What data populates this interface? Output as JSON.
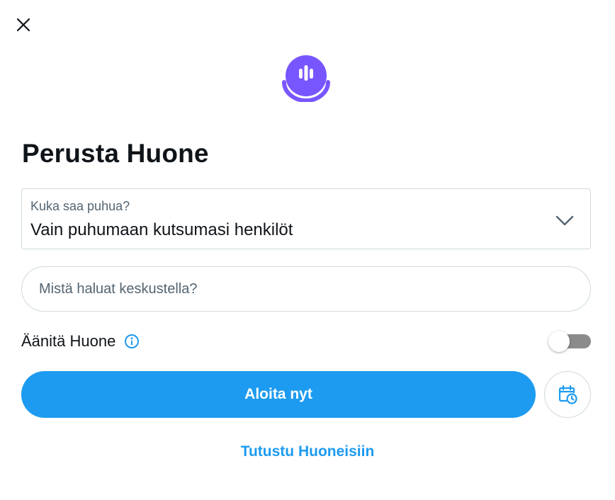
{
  "dialog": {
    "title": "Perusta Huone",
    "close_icon": "close-icon",
    "logo_icon": "spaces-logo-icon",
    "accent_color": "#1d9bf0",
    "logo_color": "#7856ff"
  },
  "speaker_select": {
    "label": "Kuka saa puhua?",
    "value": "Vain puhumaan kutsumasi henkilöt",
    "icon": "chevron-down-icon"
  },
  "topic_input": {
    "value": "",
    "placeholder": "Mistä haluat keskustella?"
  },
  "record": {
    "label": "Äänitä Huone",
    "info_icon": "info-icon",
    "enabled": false
  },
  "actions": {
    "start_label": "Aloita nyt",
    "schedule_icon": "calendar-clock-icon",
    "explore_label": "Tutustu Huoneisiin"
  }
}
